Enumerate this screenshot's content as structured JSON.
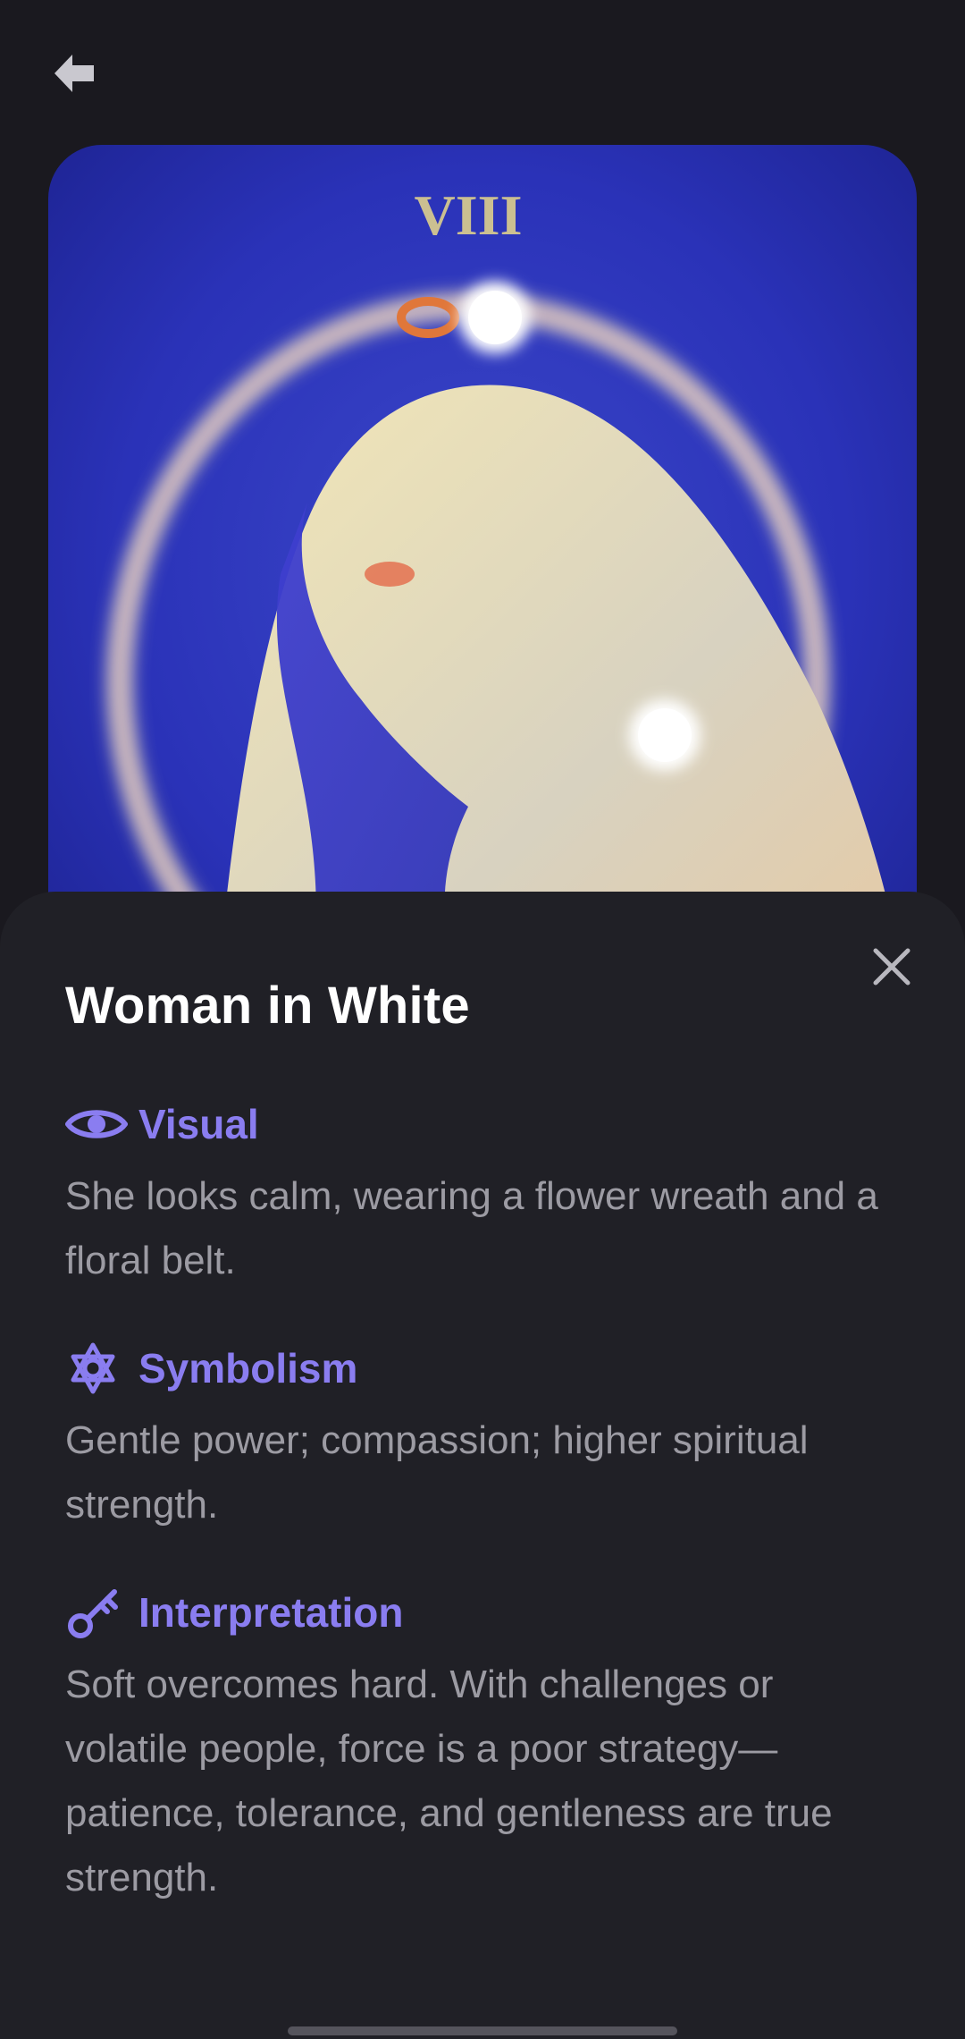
{
  "nav": {
    "back_icon": "arrow-left-icon"
  },
  "card_image": {
    "numeral": "VIII"
  },
  "sheet": {
    "close_icon": "close-icon",
    "title": "Woman in White",
    "accent_color": "#8a7df0",
    "sections": [
      {
        "icon": "eye-icon",
        "label": "Visual",
        "text": "She looks calm, wearing a flower wreath and a floral belt."
      },
      {
        "icon": "symbol-icon",
        "label": "Symbolism",
        "text": "Gentle power; compassion; higher spiritual strength."
      },
      {
        "icon": "key-icon",
        "label": "Interpretation",
        "text": "Soft overcomes hard. With challenges or volatile people, force is a poor strategy—patience, tolerance, and gentleness are true strength."
      }
    ]
  }
}
